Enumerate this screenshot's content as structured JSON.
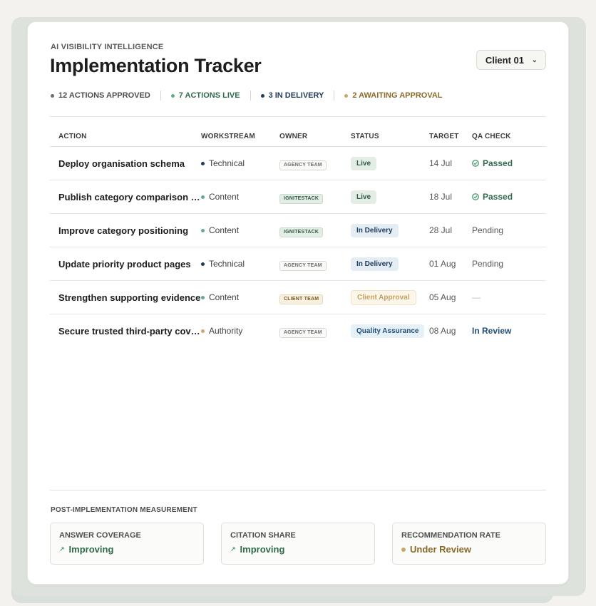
{
  "header": {
    "eyebrow": "AI VISIBILITY INTELLIGENCE",
    "title": "Implementation Tracker",
    "client_selector": "Client 01"
  },
  "summary": [
    {
      "label": "12 ACTIONS APPROVED",
      "dot_color": "#6b6e6c",
      "text_color": "#4a4d4b"
    },
    {
      "label": "7 ACTIONS LIVE",
      "dot_color": "#5fae86",
      "text_color": "#2f6b4d"
    },
    {
      "label": "3 IN DELIVERY",
      "dot_color": "#1f3b5a",
      "text_color": "#1f3b5a"
    },
    {
      "label": "2 AWAITING APPROVAL",
      "dot_color": "#c8a965",
      "text_color": "#8a6a2a"
    }
  ],
  "table": {
    "columns": [
      "ACTION",
      "WORKSTREAM",
      "OWNER",
      "STATUS",
      "TARGET",
      "QA CHECK"
    ],
    "rows": [
      {
        "action": "Deploy organisation schema",
        "workstream": "Technical",
        "owner": "AGENCY TEAM",
        "status": "Live",
        "target": "14 Jul",
        "qa": "Passed"
      },
      {
        "action": "Publish category comparison pa…",
        "workstream": "Content",
        "owner": "IGNITESTACK",
        "status": "Live",
        "target": "18 Jul",
        "qa": "Passed"
      },
      {
        "action": "Improve category positioning",
        "workstream": "Content",
        "owner": "IGNITESTACK",
        "status": "In Delivery",
        "target": "28 Jul",
        "qa": "Pending"
      },
      {
        "action": "Update priority product pages",
        "workstream": "Technical",
        "owner": "AGENCY TEAM",
        "status": "In Delivery",
        "target": "01 Aug",
        "qa": "Pending"
      },
      {
        "action": "Strengthen supporting evidence",
        "workstream": "Content",
        "owner": "CLIENT TEAM",
        "status": "Client Approval",
        "target": "05 Aug",
        "qa": "—"
      },
      {
        "action": "Secure trusted third-party cover…",
        "workstream": "Authority",
        "owner": "AGENCY TEAM",
        "status": "Quality Assurance",
        "target": "08 Aug",
        "qa": "In Review"
      }
    ]
  },
  "measurement": {
    "title": "POST-IMPLEMENTATION MEASUREMENT",
    "metrics": [
      {
        "label": "ANSWER COVERAGE",
        "value": "Improving",
        "icon": "trend-up-icon"
      },
      {
        "label": "CITATION SHARE",
        "value": "Improving",
        "icon": "trend-up-icon"
      },
      {
        "label": "RECOMMENDATION RATE",
        "value": "Under Review",
        "icon": "pending-dot-icon"
      }
    ]
  },
  "colors": {
    "technical": "#1f3b5a",
    "content": "#5fae86",
    "authority": "#c8a965",
    "passed": "#2f6b4d",
    "in_review": "#1f4f7a"
  }
}
